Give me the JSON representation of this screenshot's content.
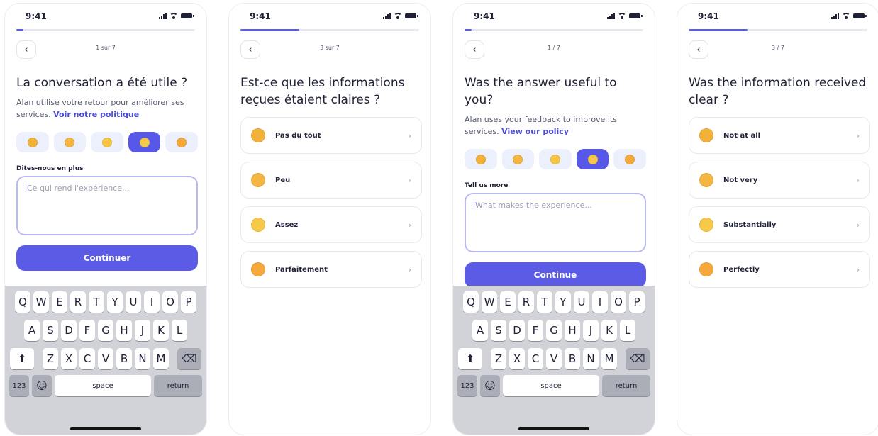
{
  "status": {
    "time": "9:41"
  },
  "colors": {
    "accent": "#5b5be6",
    "link": "#4b4bd6",
    "mood_bg": "#eceffc"
  },
  "moods": [
    {
      "icon": "angry-face-icon",
      "color": "#f2b23a"
    },
    {
      "icon": "sad-face-icon",
      "color": "#f4b640"
    },
    {
      "icon": "neutral-face-icon",
      "color": "#f6c544"
    },
    {
      "icon": "happy-face-icon",
      "color": "#f7c948"
    },
    {
      "icon": "star-eyes-face-icon",
      "color": "#f5a93b"
    }
  ],
  "keyboard": {
    "row1": [
      "Q",
      "W",
      "E",
      "R",
      "T",
      "Y",
      "U",
      "I",
      "O",
      "P"
    ],
    "row2": [
      "A",
      "S",
      "D",
      "F",
      "G",
      "H",
      "J",
      "K",
      "L"
    ],
    "row3": [
      "Z",
      "X",
      "C",
      "V",
      "B",
      "N",
      "M"
    ],
    "numbers": "123",
    "space": "space",
    "return": "return",
    "shift_glyph": "⬆",
    "delete_glyph": "⌫",
    "emoji_glyph": "☺"
  },
  "screens": [
    {
      "progress": 0.04,
      "back_glyph": "‹",
      "step": "1 sur 7",
      "title": "La conversation a été utile ?",
      "subtitle": "Alan utilise votre retour pour améliorer ses services. ",
      "link": "Voir notre politique",
      "selected_mood": 3,
      "label": "Dites-nous en plus",
      "placeholder": "Ce qui rend l'expérience...",
      "cta": "Continuer"
    },
    {
      "progress": 0.33,
      "back_glyph": "‹",
      "step": "3 sur 7",
      "title": "Est-ce que les informations reçues étaient claires ?",
      "chevron_glyph": "›",
      "options": [
        "Pas du tout",
        "Peu",
        "Assez",
        "Parfaitement"
      ]
    },
    {
      "progress": 0.04,
      "back_glyph": "‹",
      "step": "1 / 7",
      "title": "Was the answer useful to you?",
      "subtitle": "Alan uses your feedback to improve its services. ",
      "link": "View our policy",
      "selected_mood": 3,
      "label": "Tell us more",
      "placeholder": "What makes the experience...",
      "cta": "Continue"
    },
    {
      "progress": 0.33,
      "back_glyph": "‹",
      "step": "3 / 7",
      "title": "Was the information received clear ?",
      "chevron_glyph": "›",
      "options": [
        "Not at all",
        "Not very",
        "Substantially",
        "Perfectly"
      ]
    }
  ]
}
